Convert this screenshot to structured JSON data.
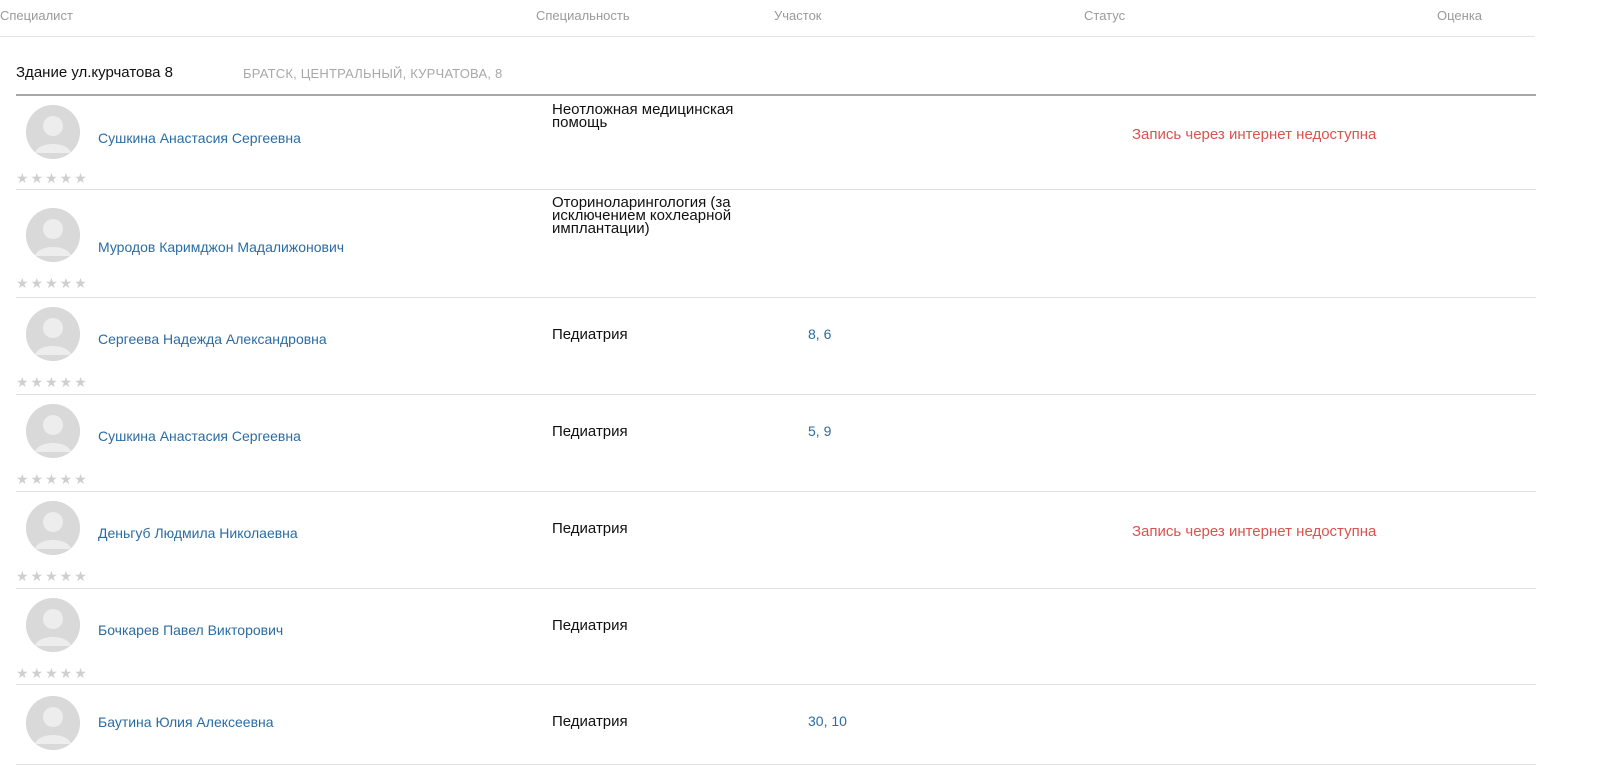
{
  "header": {
    "specialist": "Специалист",
    "specialty": "Специальность",
    "plot": "Участок",
    "status": "Статус",
    "rating": "Оценка"
  },
  "building": {
    "name": "Здание ул.курчатова 8",
    "address": "БРАТСК, ЦЕНТРАЛЬНЫЙ, КУРЧАТОВА, 8"
  },
  "rows": [
    {
      "name": "Сушкина Анастасия Сергеевна",
      "specialty_lines": [
        "Неотложная медицинская",
        "помощь"
      ],
      "plot": "",
      "status": "Запись через интернет недоступна",
      "stars": "★★★★★"
    },
    {
      "name": "Муродов Каримджон Мадалижонович",
      "specialty_lines": [
        "Оториноларингология (за",
        "исключением кохлеарной",
        "имплантации)"
      ],
      "plot": "",
      "status": "",
      "stars": "★★★★★"
    },
    {
      "name": "Сергеева Надежда Александровна",
      "specialty_lines": [
        "Педиатрия"
      ],
      "plot": "8, 6",
      "status": "",
      "stars": "★★★★★"
    },
    {
      "name": "Сушкина Анастасия Сергеевна",
      "specialty_lines": [
        "Педиатрия"
      ],
      "plot": "5, 9",
      "status": "",
      "stars": "★★★★★"
    },
    {
      "name": "Деньгуб Людмила Николаевна",
      "specialty_lines": [
        "Педиатрия"
      ],
      "plot": "",
      "status": "Запись через интернет недоступна",
      "stars": "★★★★★"
    },
    {
      "name": "Бочкарев Павел Викторович",
      "specialty_lines": [
        "Педиатрия"
      ],
      "plot": "",
      "status": "",
      "stars": "★★★★★"
    },
    {
      "name": "Баутина Юлия Алексеевна",
      "specialty_lines": [
        "Педиатрия"
      ],
      "plot": "30, 10",
      "status": "",
      "stars": ""
    }
  ],
  "colors": {
    "link": "#2b6ca3",
    "status_unavailable": "#d9534f",
    "star_empty": "#cfcfcf"
  },
  "icons": {
    "avatar": "user-avatar-placeholder-icon",
    "star": "star-icon"
  }
}
